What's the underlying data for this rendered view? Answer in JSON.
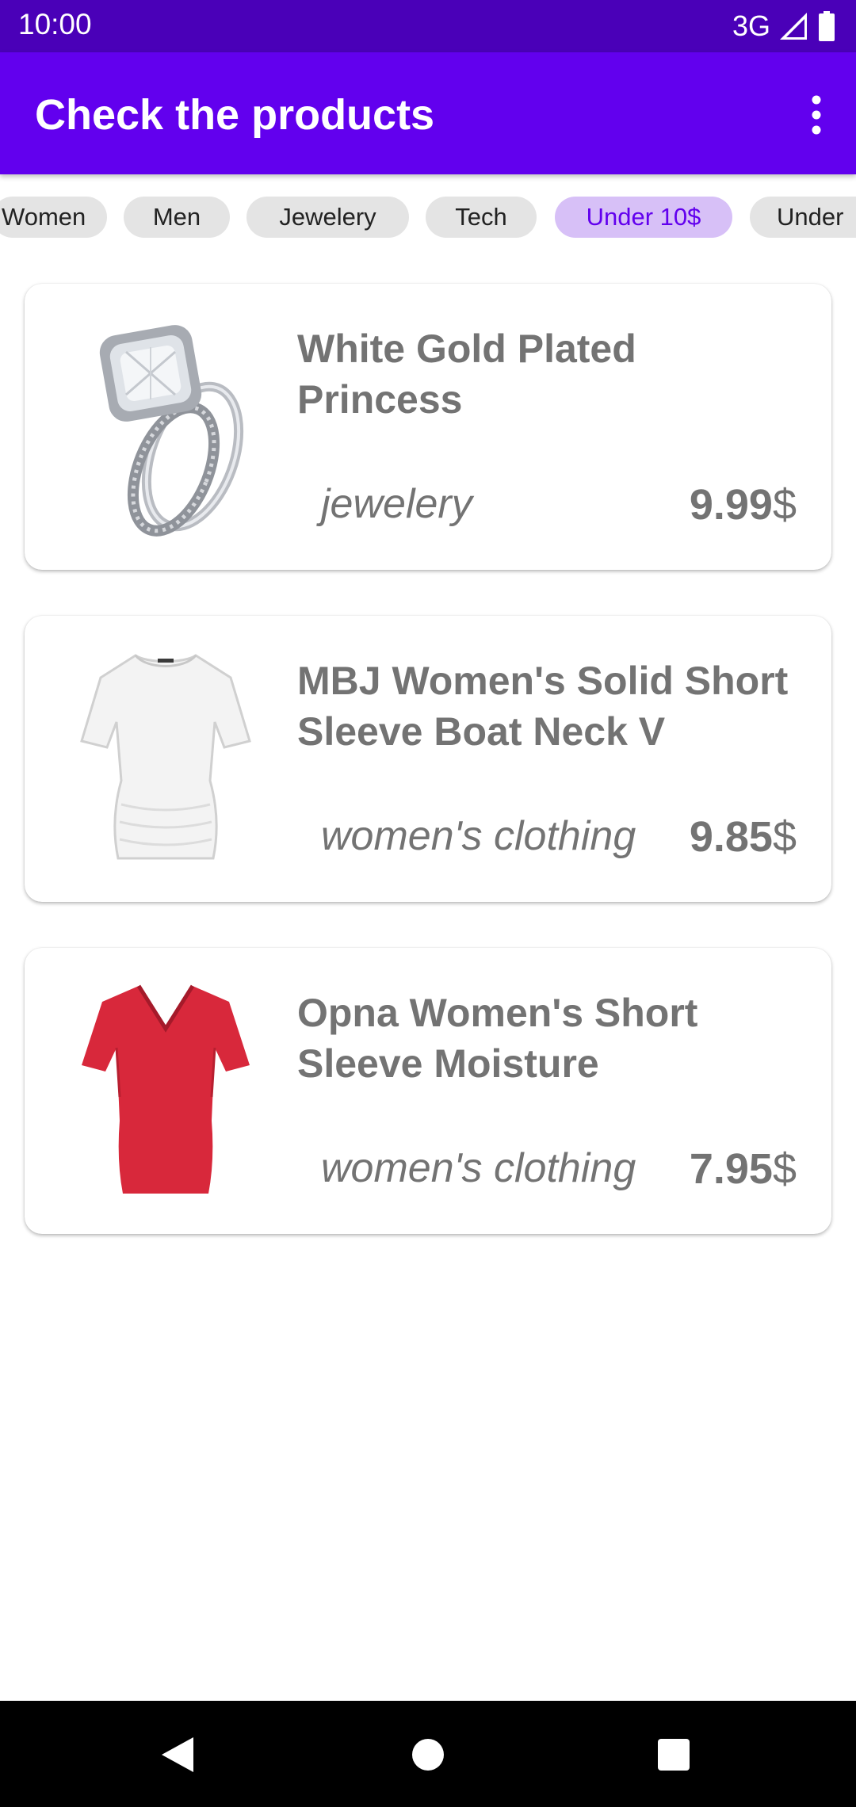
{
  "status_bar": {
    "time": "10:00",
    "network": "3G",
    "signal_icon": "signal-icon",
    "battery_icon": "battery-icon"
  },
  "app_bar": {
    "title": "Check the products",
    "menu_icon": "more-vert-icon",
    "background_color": "#6200ee"
  },
  "filters": {
    "chips": [
      {
        "label": "Women",
        "visible_text": "Women",
        "selected": false
      },
      {
        "label": "Men",
        "selected": false
      },
      {
        "label": "Jewelery",
        "selected": false
      },
      {
        "label": "Tech",
        "selected": false
      },
      {
        "label": "Under 10$",
        "selected": true
      },
      {
        "label": "Under",
        "selected": false
      }
    ],
    "selected_color": "#d7c0f7",
    "selected_text_color": "#6200ee"
  },
  "products": [
    {
      "title": "White Gold Plated Princess",
      "category": "jewelery",
      "price": "9.99",
      "currency": "$",
      "image_icon": "ring-image"
    },
    {
      "title": "MBJ Women's Solid Short Sleeve Boat Neck V",
      "category": "women's clothing",
      "price": "9.85",
      "currency": "$",
      "image_icon": "white-tshirt-image"
    },
    {
      "title": "Opna Women's Short Sleeve Moisture",
      "category": "women's clothing",
      "price": "7.95",
      "currency": "$",
      "image_icon": "red-tshirt-image"
    }
  ],
  "nav_bar": {
    "back_icon": "back-icon",
    "home_icon": "home-icon",
    "recents_icon": "recents-icon"
  }
}
